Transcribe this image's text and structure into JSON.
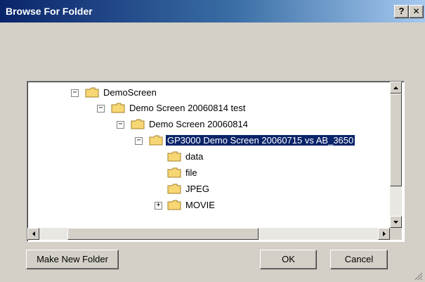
{
  "window": {
    "title": "Browse For Folder",
    "help_label": "?",
    "close_label": "✕"
  },
  "tree": {
    "items": [
      {
        "label": "DemoScreen",
        "expander": "−",
        "selected": false
      },
      {
        "label": "Demo Screen 20060814 test",
        "expander": "−",
        "selected": false
      },
      {
        "label": "Demo Screen 20060814",
        "expander": "−",
        "selected": false
      },
      {
        "label": "GP3000 Demo Screen 20060715 vs AB_3650",
        "expander": "−",
        "selected": true
      },
      {
        "label": "data",
        "expander": "",
        "selected": false
      },
      {
        "label": "file",
        "expander": "",
        "selected": false
      },
      {
        "label": "JPEG",
        "expander": "",
        "selected": false
      },
      {
        "label": "MOVIE",
        "expander": "+",
        "selected": false
      }
    ]
  },
  "buttons": {
    "make_new_folder": "Make New Folder",
    "ok": "OK",
    "cancel": "Cancel"
  },
  "colors": {
    "title_bar_start": "#0a246a",
    "title_bar_end": "#a6caf0",
    "selection": "#0a246a",
    "face": "#d4d0c8",
    "folder": "#f7d674"
  }
}
